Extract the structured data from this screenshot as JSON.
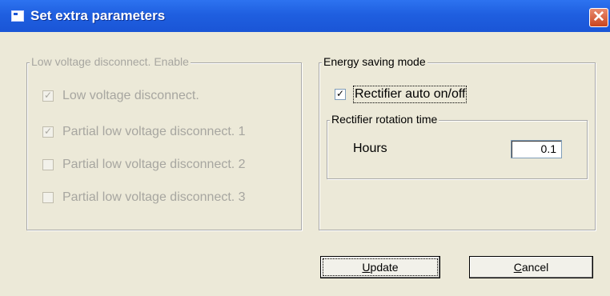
{
  "window": {
    "title": "Set extra parameters",
    "close_glyph": "✕",
    "icon": "window-app-icon"
  },
  "lvd_group": {
    "legend": "Low voltage disconnect. Enable",
    "items": [
      {
        "label": "Low voltage disconnect.",
        "checked": true
      },
      {
        "label": "Partial low voltage disconnect. 1",
        "checked": true
      },
      {
        "label": "Partial low voltage disconnect. 2",
        "checked": false
      },
      {
        "label": "Partial low voltage disconnect. 3",
        "checked": false
      }
    ]
  },
  "energy_group": {
    "legend": "Energy saving mode",
    "rectifier_auto": {
      "label": "Rectifier auto on/off",
      "checked": true
    },
    "rotation_group": {
      "legend": "Rectifier rotation time",
      "hours_label": "Hours",
      "hours_value": "0.1"
    }
  },
  "buttons": {
    "update_mnemonic": "U",
    "update_rest": "pdate",
    "cancel_mnemonic": "C",
    "cancel_rest": "ancel"
  },
  "check_glyph": "✓"
}
